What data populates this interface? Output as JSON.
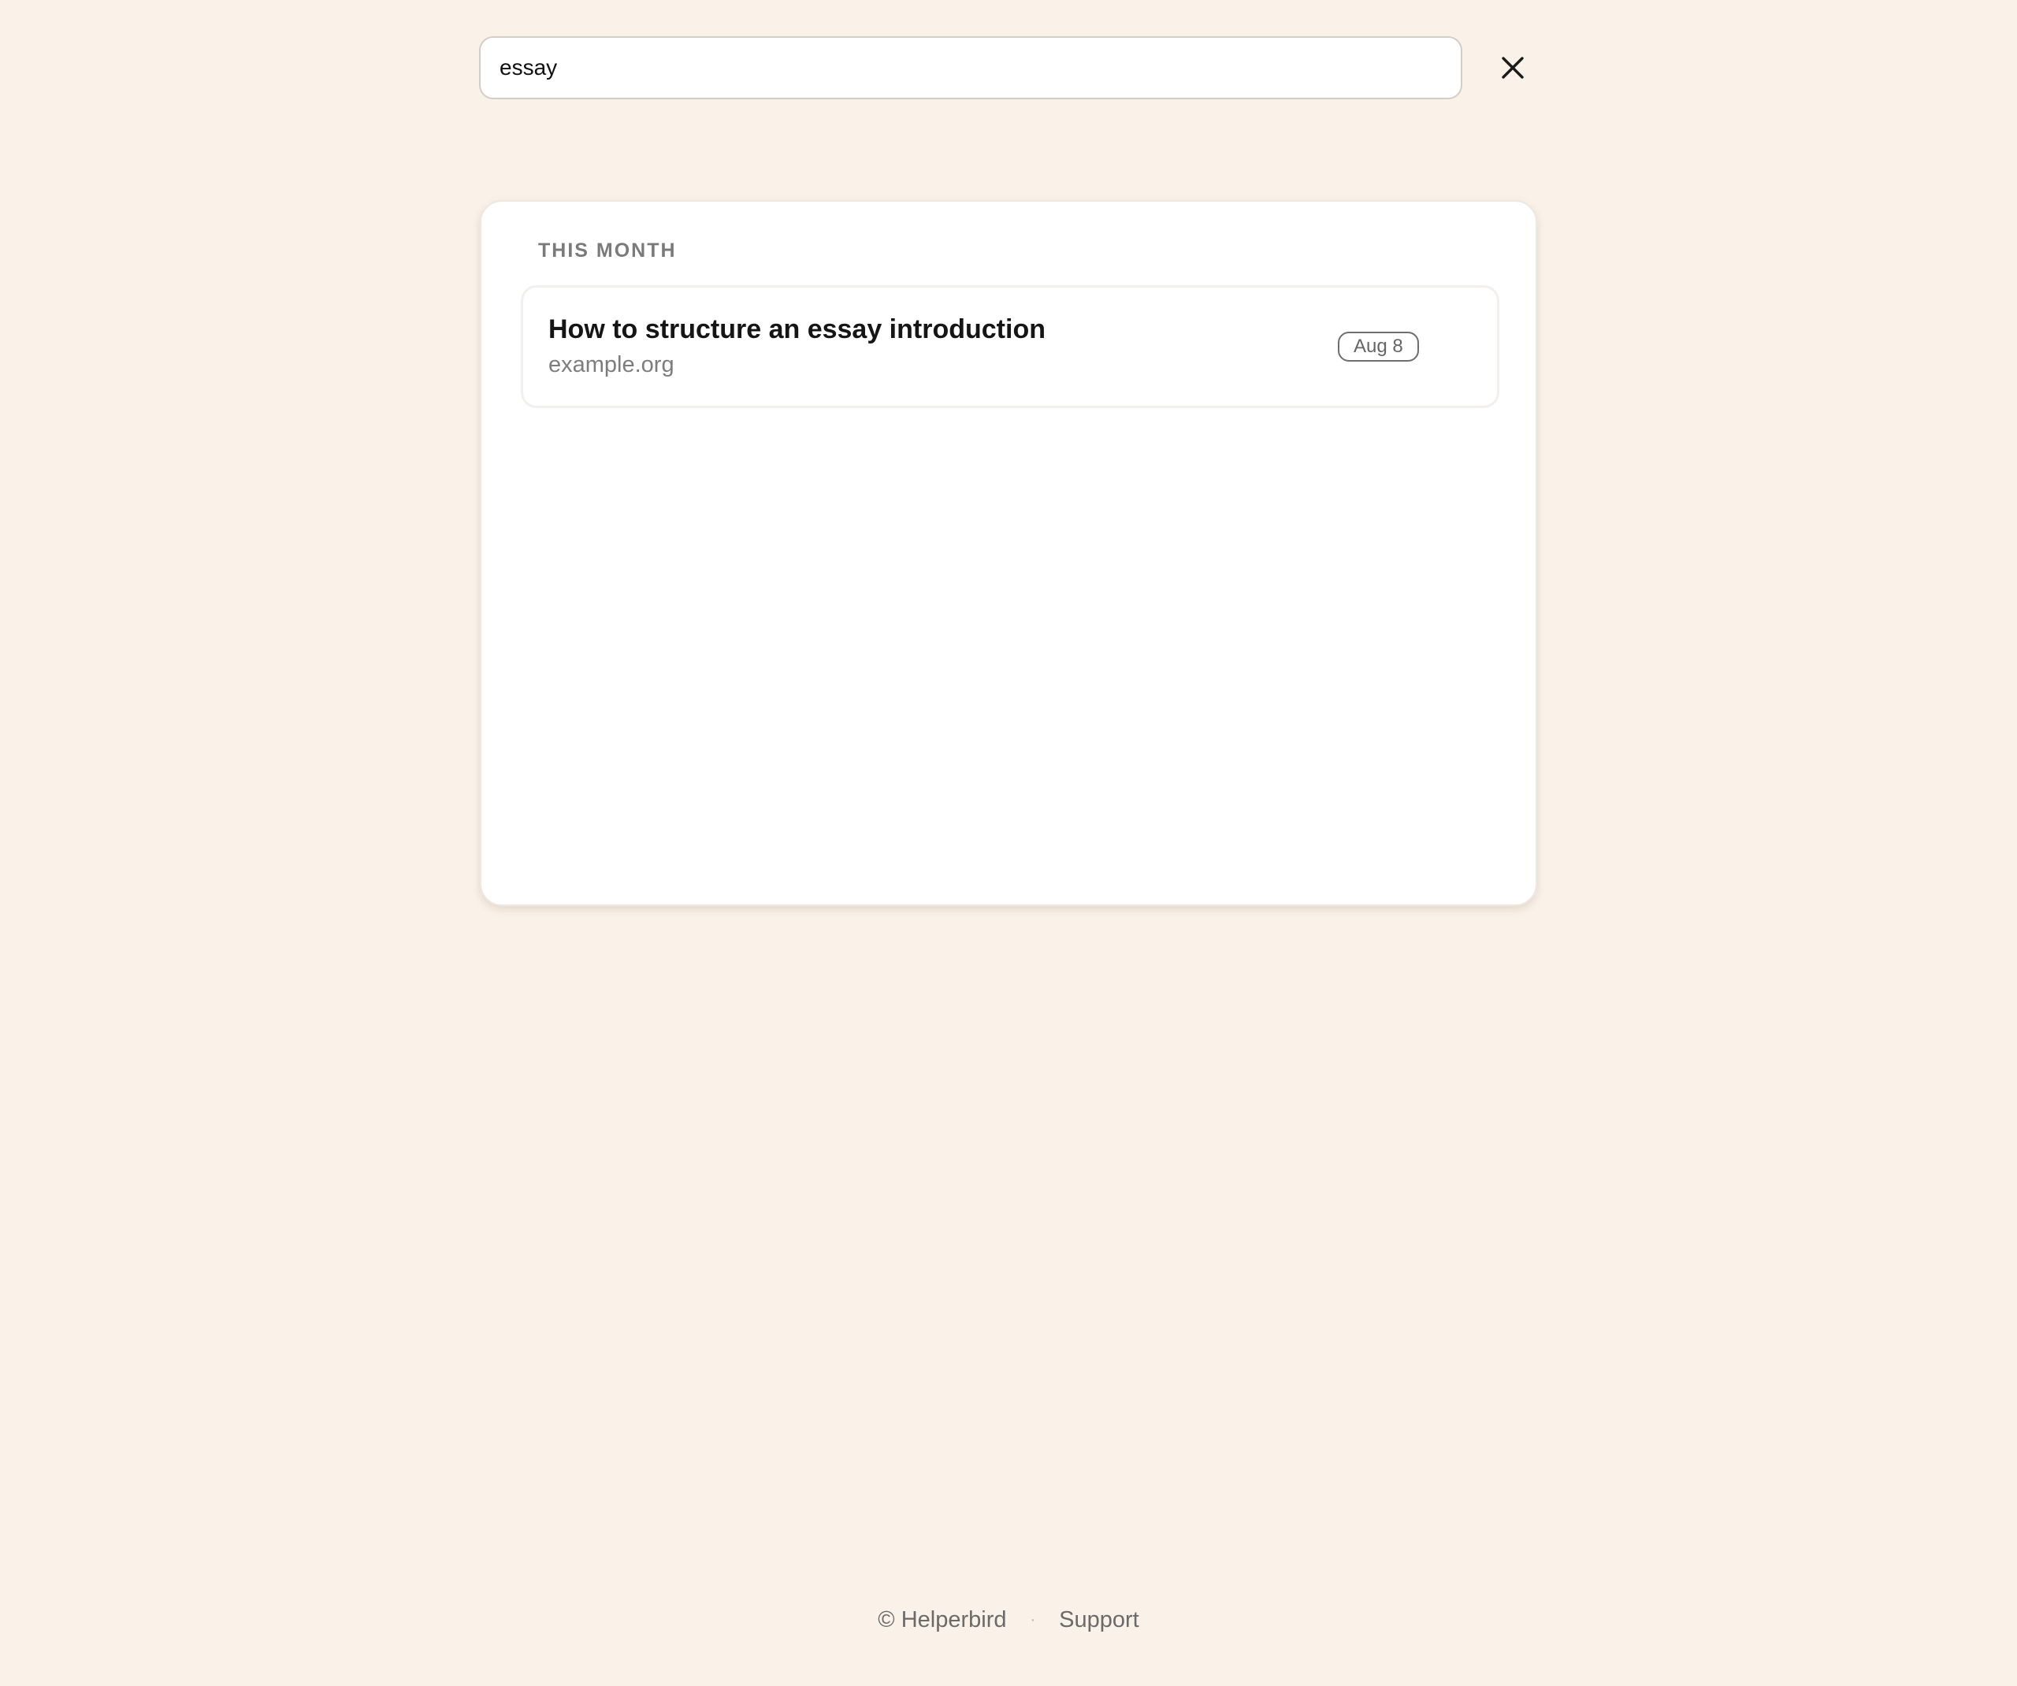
{
  "search": {
    "value": "essay",
    "close_icon": "close-icon"
  },
  "results": {
    "section_heading": "THIS MONTH",
    "items": [
      {
        "title": "How to structure an essay introduction",
        "domain": "example.org",
        "date": "Aug 8"
      }
    ]
  },
  "footer": {
    "copyright": "© Helperbird",
    "separator": "·",
    "support": "Support"
  },
  "colors": {
    "background": "#FAF1E8",
    "card": "#FFFFFF",
    "text_primary": "#151515",
    "text_muted": "#7D7D7D"
  }
}
